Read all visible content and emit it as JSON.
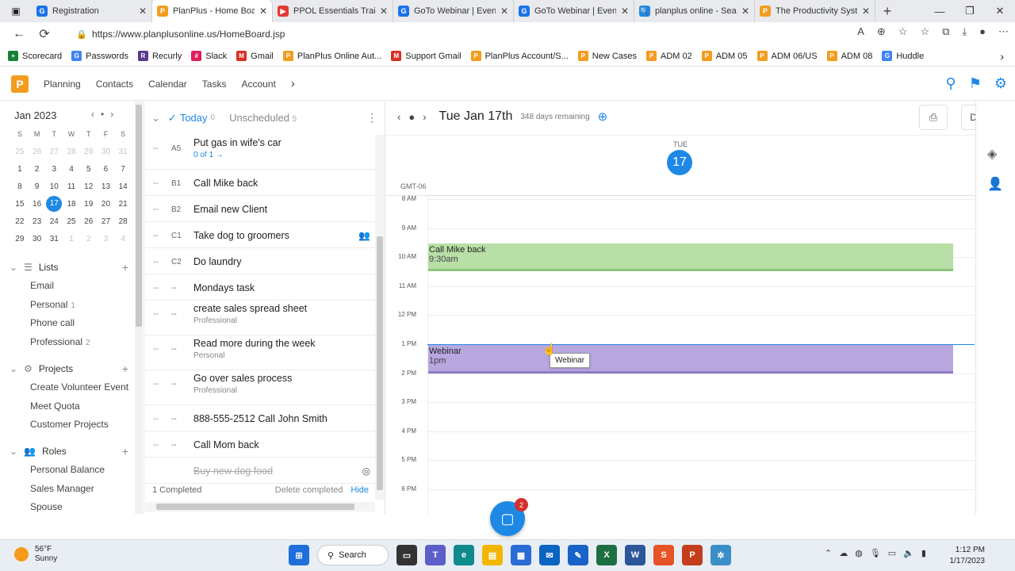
{
  "browser": {
    "tabs": [
      {
        "title": "Registration",
        "fav": "G",
        "color": "#1a73e8"
      },
      {
        "title": "PlanPlus - Home Board",
        "fav": "P",
        "color": "#f39c1f",
        "active": true
      },
      {
        "title": "PPOL Essentials Training",
        "fav": "▶",
        "color": "#e53935"
      },
      {
        "title": "GoTo Webinar | Event",
        "fav": "G",
        "color": "#1a73e8"
      },
      {
        "title": "GoTo Webinar | Event",
        "fav": "G",
        "color": "#1a73e8"
      },
      {
        "title": "planplus online - Search",
        "fav": "🔍",
        "color": "#1e88e5"
      },
      {
        "title": "The Productivity System",
        "fav": "P",
        "color": "#f39c1f"
      }
    ],
    "url": "https://www.planplusonline.us/HomeBoard.jsp",
    "bookmarks": [
      {
        "label": "Scorecard",
        "icon": "+",
        "color": "#188038"
      },
      {
        "label": "Passwords",
        "icon": "G",
        "color": "#4285f4"
      },
      {
        "label": "Recurly",
        "icon": "R",
        "color": "#5b3a8c"
      },
      {
        "label": "Slack",
        "icon": "#",
        "color": "#e01e5a"
      },
      {
        "label": "Gmail",
        "icon": "M",
        "color": "#d93025"
      },
      {
        "label": "PlanPlus Online Aut...",
        "icon": "P",
        "color": "#f39c1f"
      },
      {
        "label": "Support Gmail",
        "icon": "M",
        "color": "#d93025"
      },
      {
        "label": "PlanPlus Account/S...",
        "icon": "P",
        "color": "#f39c1f"
      },
      {
        "label": "New Cases",
        "icon": "P",
        "color": "#f39c1f"
      },
      {
        "label": "ADM 02",
        "icon": "P",
        "color": "#f39c1f"
      },
      {
        "label": "ADM 05",
        "icon": "P",
        "color": "#f39c1f"
      },
      {
        "label": "ADM 06/US",
        "icon": "P",
        "color": "#f39c1f"
      },
      {
        "label": "ADM 08",
        "icon": "P",
        "color": "#f39c1f"
      },
      {
        "label": "Huddle",
        "icon": "G",
        "color": "#4285f4"
      }
    ]
  },
  "app": {
    "logo": "P",
    "nav": [
      "Planning",
      "Contacts",
      "Calendar",
      "Tasks",
      "Account"
    ]
  },
  "minical": {
    "month": "Jan 2023",
    "weekdays": [
      "S",
      "M",
      "T",
      "W",
      "T",
      "F",
      "S"
    ],
    "weeks": [
      [
        {
          "d": "25",
          "dim": true
        },
        {
          "d": "26",
          "dim": true
        },
        {
          "d": "27",
          "dim": true
        },
        {
          "d": "28",
          "dim": true
        },
        {
          "d": "29",
          "dim": true
        },
        {
          "d": "30",
          "dim": true
        },
        {
          "d": "31",
          "dim": true
        }
      ],
      [
        {
          "d": "1"
        },
        {
          "d": "2"
        },
        {
          "d": "3"
        },
        {
          "d": "4"
        },
        {
          "d": "5"
        },
        {
          "d": "6"
        },
        {
          "d": "7"
        }
      ],
      [
        {
          "d": "8"
        },
        {
          "d": "9"
        },
        {
          "d": "10"
        },
        {
          "d": "11"
        },
        {
          "d": "12"
        },
        {
          "d": "13"
        },
        {
          "d": "14"
        }
      ],
      [
        {
          "d": "15"
        },
        {
          "d": "16"
        },
        {
          "d": "17",
          "sel": true
        },
        {
          "d": "18"
        },
        {
          "d": "19"
        },
        {
          "d": "20"
        },
        {
          "d": "21"
        }
      ],
      [
        {
          "d": "22"
        },
        {
          "d": "23"
        },
        {
          "d": "24"
        },
        {
          "d": "25"
        },
        {
          "d": "26"
        },
        {
          "d": "27"
        },
        {
          "d": "28"
        }
      ],
      [
        {
          "d": "29"
        },
        {
          "d": "30"
        },
        {
          "d": "31"
        },
        {
          "d": "1",
          "dim": true
        },
        {
          "d": "2",
          "dim": true
        },
        {
          "d": "3",
          "dim": true
        },
        {
          "d": "4",
          "dim": true
        }
      ]
    ]
  },
  "sidebar": {
    "lists_label": "Lists",
    "lists": [
      {
        "label": "Email",
        "count": ""
      },
      {
        "label": "Personal",
        "count": "1"
      },
      {
        "label": "Phone call",
        "count": ""
      },
      {
        "label": "Professional",
        "count": "2"
      }
    ],
    "projects_label": "Projects",
    "projects": [
      "Create Volunteer Event",
      "Meet Quota",
      "Customer Projects"
    ],
    "roles_label": "Roles",
    "roles": [
      "Personal Balance",
      "Sales Manager",
      "Spouse"
    ]
  },
  "tasks": {
    "today_label": "Today",
    "today_count": "0",
    "unscheduled_label": "Unscheduled",
    "unscheduled_count": "5",
    "items": [
      {
        "pri": "A5",
        "title": "Put gas in wife's car",
        "sub": "0 of 1 →",
        "sublink": true
      },
      {
        "pri": "B1",
        "title": "Call Mike back",
        "sub": ""
      },
      {
        "pri": "B2",
        "title": "Email new Client",
        "sub": ""
      },
      {
        "pri": "C1",
        "title": "Take dog to groomers",
        "sub": "",
        "icon": true
      },
      {
        "pri": "C2",
        "title": "Do laundry",
        "sub": ""
      },
      {
        "pri": "--",
        "title": "Mondays task",
        "sub": ""
      },
      {
        "pri": "--",
        "title": "create sales spread sheet",
        "sub": "Professional"
      },
      {
        "pri": "--",
        "title": "Read more during the week",
        "sub": "Personal"
      },
      {
        "pri": "--",
        "title": "Go over sales process",
        "sub": "Professional"
      },
      {
        "pri": "--",
        "title": "888-555-2512 Call John Smith",
        "sub": ""
      },
      {
        "pri": "--",
        "title": "Call Mom back",
        "sub": ""
      },
      {
        "pri": "",
        "title": "Buy new dog food",
        "sub": "",
        "done": true
      }
    ],
    "completed_text": "1 Completed",
    "delete_completed": "Delete completed",
    "hide": "Hide"
  },
  "calendar": {
    "date_label": "Tue Jan 17th",
    "remaining": "348 days remaining",
    "view": "Day",
    "dow": "TUE",
    "daynum": "17",
    "timezone": "GMT-06",
    "hours": [
      "8 AM",
      "9 AM",
      "10 AM",
      "11 AM",
      "12 PM",
      "1 PM",
      "2 PM",
      "3 PM",
      "4 PM",
      "5 PM",
      "6 PM"
    ],
    "events": [
      {
        "title": "Call Mike back",
        "time": "9:30am",
        "start": 9.5,
        "end": 10.5,
        "color": "#b7dfa6",
        "border": "#8cc47a"
      },
      {
        "title": "Webinar",
        "time": "1pm",
        "start": 13.0,
        "end": 14.0,
        "color": "#b9a7e0",
        "border": "#8f7bc6"
      }
    ],
    "now_hour": 13.0,
    "tooltip": "Webinar"
  },
  "fab": {
    "badge": "2"
  },
  "taskbar": {
    "temp": "56°F",
    "cond": "Sunny",
    "search": "Search",
    "time": "1:12 PM",
    "date": "1/17/2023"
  }
}
